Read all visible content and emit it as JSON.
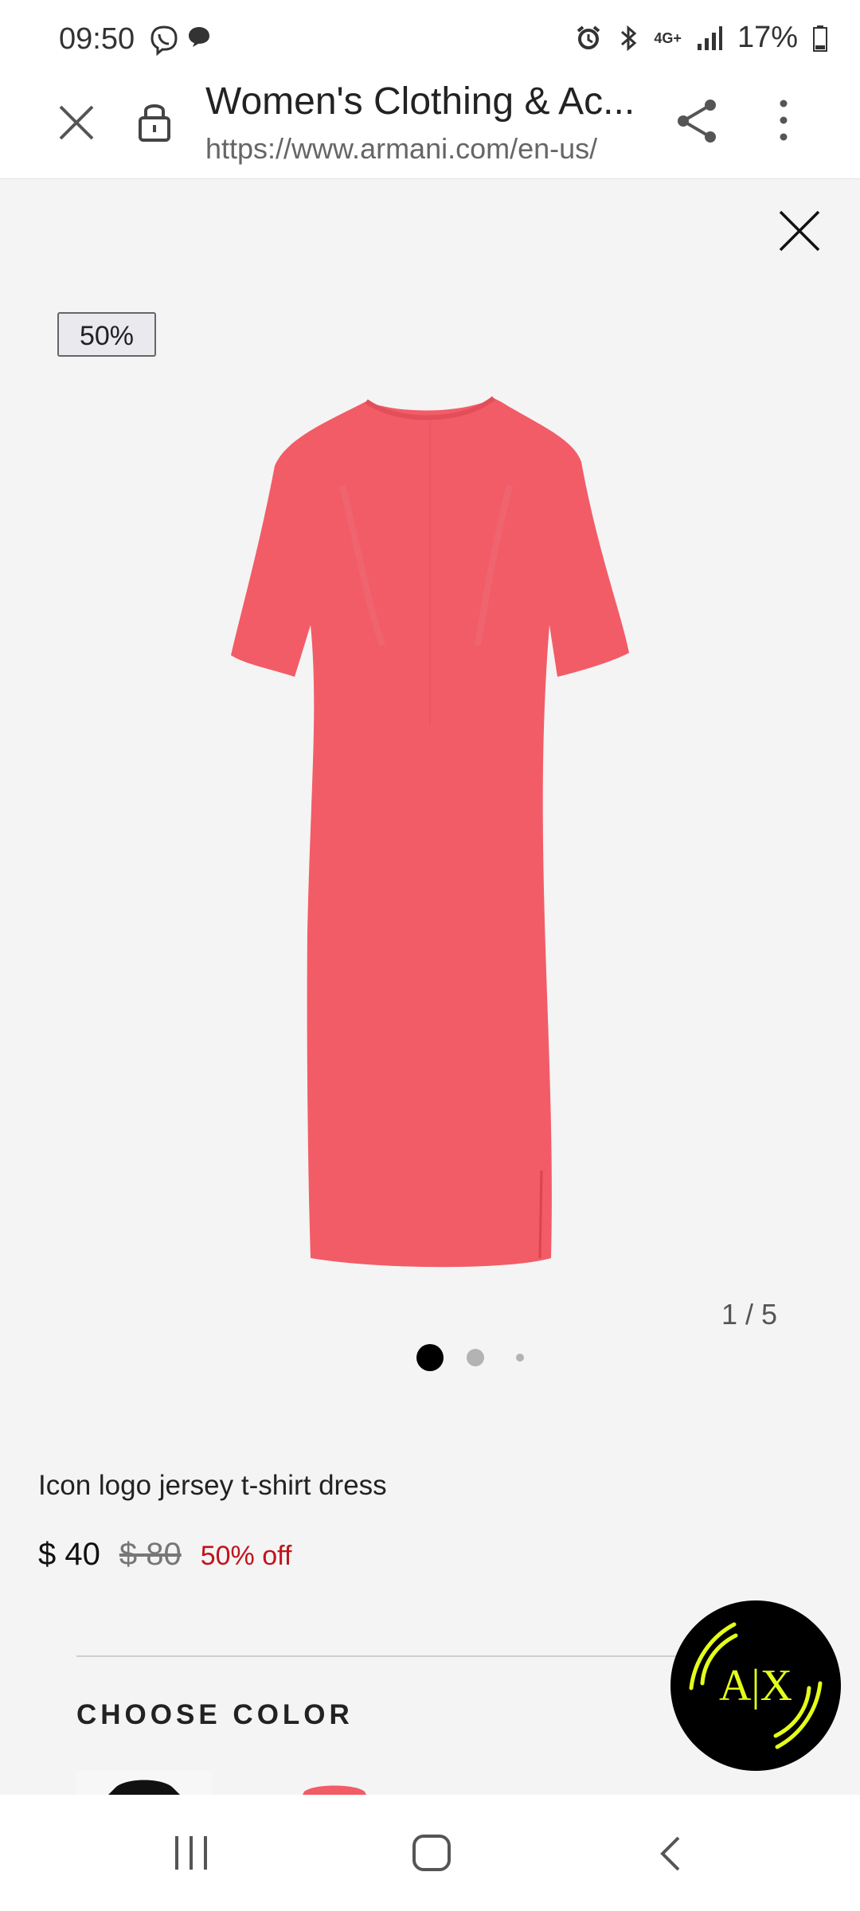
{
  "status_bar": {
    "time": "09:50",
    "battery": "17%",
    "network": "4G+"
  },
  "browser": {
    "title": "Women's Clothing & Ac...",
    "url": "https://www.armani.com/en-us/"
  },
  "product": {
    "discount_badge": "50%",
    "image_counter": "1 / 5",
    "name": "Icon logo jersey t-shirt dress",
    "price_current": "$ 40",
    "price_original": "$ 80",
    "price_discount": "50% off",
    "choose_color_label": "CHOOSE COLOR",
    "gallery": {
      "current": 1,
      "total": 5,
      "dots": 3,
      "active_dot": 0
    }
  },
  "brand_badge": {
    "text": "A|X"
  },
  "colors": {
    "accent_sale": "#c0141c",
    "dress": "#f25c67",
    "badge_glow": "#e4ff1a"
  }
}
